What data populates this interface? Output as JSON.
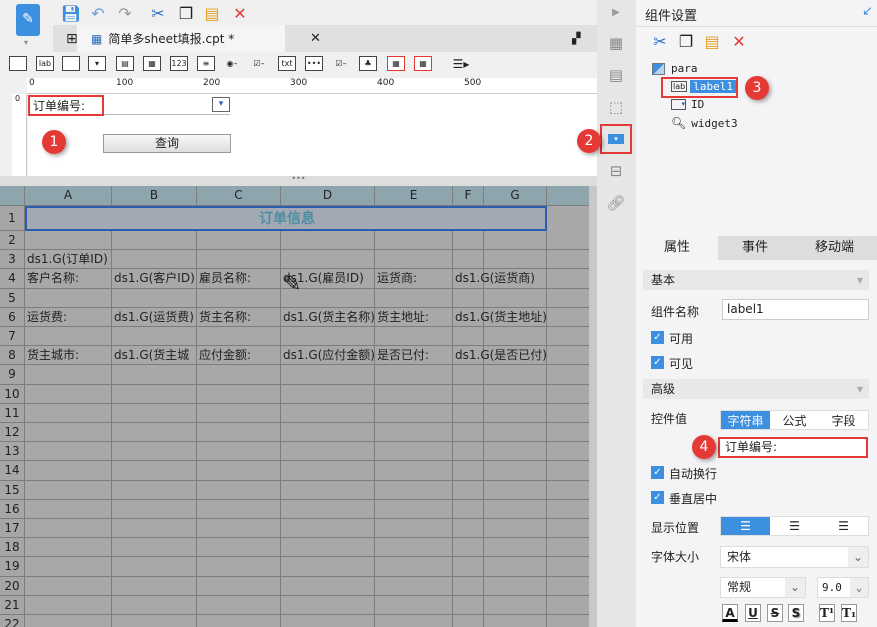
{
  "toolbar": {
    "icons": [
      "save-icon",
      "undo-icon",
      "redo-icon",
      "cut-icon",
      "copy-icon",
      "paste-icon",
      "delete-icon"
    ]
  },
  "tab": {
    "title": "简单多sheet填报.cpt *"
  },
  "ruler": {
    "ticks": [
      "0",
      "100",
      "200",
      "300",
      "400",
      "500"
    ],
    "vtick": "0"
  },
  "param": {
    "label_text": "订单编号:",
    "query_button": "查询"
  },
  "badges": [
    "1",
    "2",
    "3",
    "4"
  ],
  "grid": {
    "columns": [
      "A",
      "B",
      "C",
      "D",
      "E",
      "F",
      "G"
    ],
    "rows": [
      "1",
      "2",
      "3",
      "4",
      "5",
      "6",
      "7",
      "8",
      "9",
      "10",
      "11",
      "12",
      "13",
      "14",
      "15",
      "16",
      "17",
      "18",
      "19",
      "20",
      "21",
      "22"
    ],
    "title": "订单信息",
    "r3": [
      "ds1.G(订单ID)"
    ],
    "r4": [
      "客户名称:",
      "ds1.G(客户ID)",
      "雇员名称:",
      "ds1.G(雇员ID)",
      "运货商:",
      "ds1.G(运货商)"
    ],
    "r6": [
      "运货费:",
      "ds1.G(运货费)",
      "货主名称:",
      "ds1.G(货主名称)",
      "货主地址:",
      "ds1.G(货主地址)"
    ],
    "r8": [
      "货主城市:",
      "ds1.G(货主城",
      "应付金额:",
      "ds1.G(应付金额)",
      "是否已付:",
      "ds1.G(是否已付)"
    ]
  },
  "panel": {
    "title": "组件设置",
    "tree": {
      "root": "para",
      "items": [
        "label1",
        "ID",
        "widget3"
      ]
    },
    "tabs": [
      "属性",
      "事件",
      "移动端"
    ],
    "basic": "基本",
    "name_label": "组件名称",
    "name_value": "label1",
    "enabled": "可用",
    "visible": "可见",
    "advanced": "高级",
    "value_label": "控件值",
    "value_modes": [
      "字符串",
      "公式",
      "字段"
    ],
    "value": "订单编号:",
    "wrap": "自动换行",
    "vcenter": "垂直居中",
    "align_label": "显示位置",
    "font_label": "字体大小",
    "font": "宋体",
    "style": "常规",
    "size": "9.0",
    "format_buttons": [
      "A",
      "U",
      "S",
      "S",
      "T¹",
      "T₁"
    ]
  },
  "colors": {
    "accent": "#3d8fe0",
    "badge": "#e53935",
    "selection": "#2a5db0"
  }
}
